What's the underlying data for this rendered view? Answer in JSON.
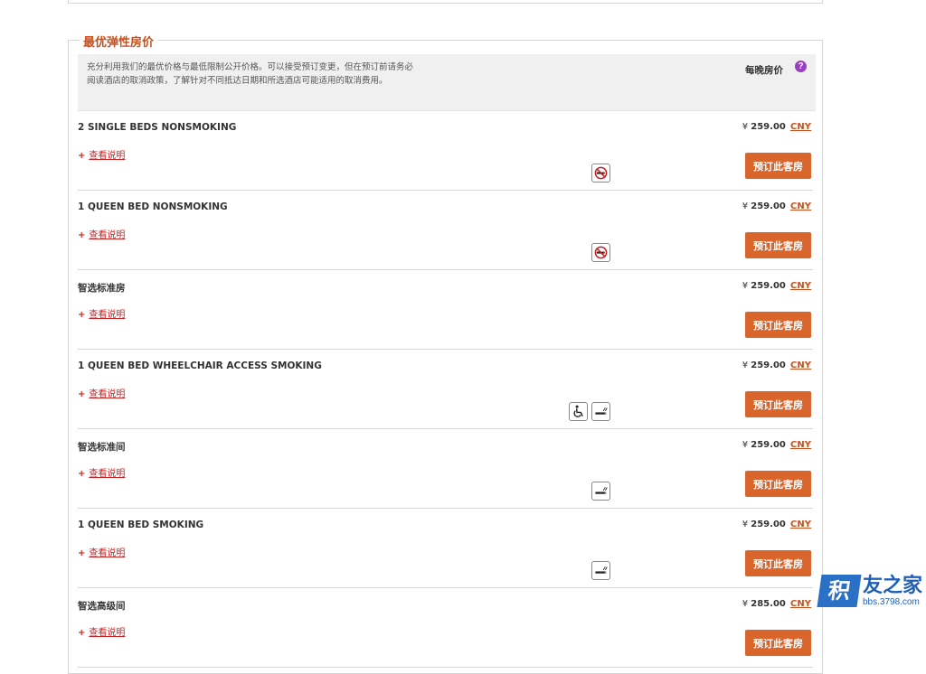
{
  "section": {
    "title": "最优弹性房价",
    "notice": "充分利用我们的最优价格与最低限制公开价格。可以接受预订变更，但在预订前请务必阅读酒店的取消政策，了解针对不同抵达日期和所选酒店可能适用的取消费用。",
    "per_night_label": "每晚房价",
    "help_icon": "?"
  },
  "common": {
    "currency_symbol": "¥",
    "currency_code": "CNY",
    "details_plus": "+",
    "details_label": "查看说明",
    "book_label": "预订此客房"
  },
  "rooms": [
    {
      "name": "2 SINGLE BEDS NONSMOKING",
      "price": "259.00",
      "amenities": [
        "no-smoking-icon"
      ]
    },
    {
      "name": "1 QUEEN BED NONSMOKING",
      "price": "259.00",
      "amenities": [
        "no-smoking-icon"
      ]
    },
    {
      "name": "智选标准房",
      "price": "259.00",
      "amenities": []
    },
    {
      "name": "1 QUEEN BED WHEELCHAIR ACCESS SMOKING",
      "price": "259.00",
      "amenities": [
        "wheelchair-icon",
        "smoking-icon"
      ]
    },
    {
      "name": "智选标准间",
      "price": "259.00",
      "amenities": [
        "smoking-icon"
      ]
    },
    {
      "name": "1 QUEEN BED SMOKING",
      "price": "259.00",
      "amenities": [
        "smoking-icon"
      ]
    },
    {
      "name": "智选高级间",
      "price": "285.00",
      "amenities": []
    }
  ],
  "watermark": {
    "badge": "积",
    "name": "友之家",
    "url": "bbs.3798.com"
  },
  "colors": {
    "accent": "#d8662c",
    "link": "#cc2222"
  }
}
